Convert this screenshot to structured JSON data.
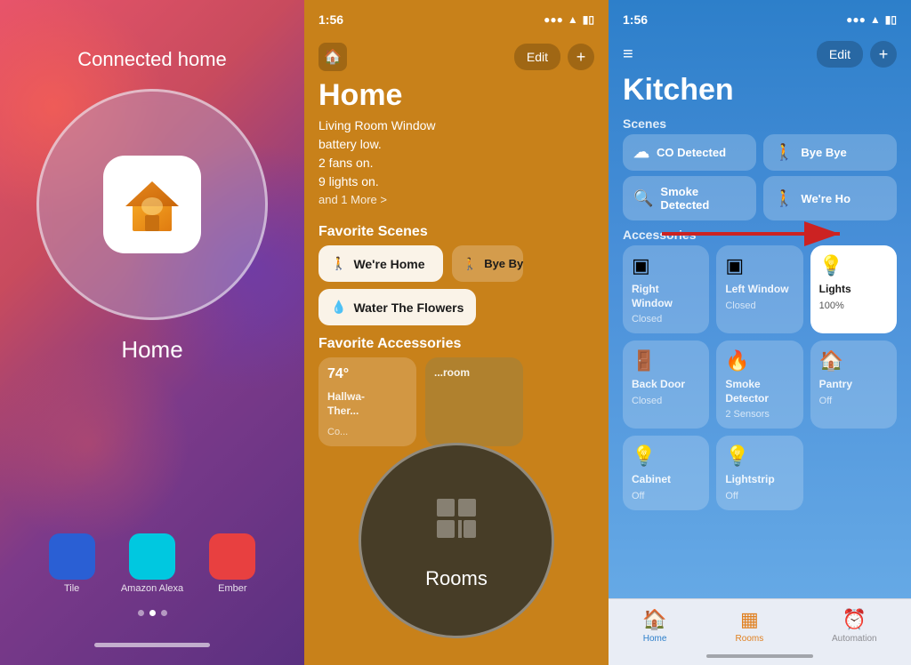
{
  "panel1": {
    "status_time": "",
    "connected_home": "Connected home",
    "home_label": "Home",
    "bottom_apps": [
      {
        "label": "Tile",
        "color": "#3a7bd5"
      },
      {
        "label": "Amazon Alexa",
        "color": "#1a73e8"
      },
      {
        "label": "Ember",
        "color": "#e84040"
      }
    ]
  },
  "panel2": {
    "status_time": "1:56",
    "title": "Home",
    "subtitle_line1": "Living Room Window",
    "subtitle_line2": "battery low.",
    "subtitle_line3": "2 fans on.",
    "subtitle_line4": "9 lights on.",
    "more_text": "and 1 More >",
    "favorite_scenes_label": "Favorite Scenes",
    "scenes": [
      {
        "icon": "🚶",
        "label": "We're Home"
      },
      {
        "icon": "🚶",
        "label": "Bye Bye"
      }
    ],
    "scene_water": {
      "icon": "💧",
      "label": "Water The Flowers"
    },
    "favorite_accessories_label": "Favorite Accessories",
    "accessories": [
      {
        "temp": "74°",
        "name": "Hallwa-\nTher...",
        "sub": "Co..."
      },
      {
        "name": "...room",
        "sub": ""
      }
    ],
    "rooms_label": "Rooms",
    "edit_label": "Edit"
  },
  "panel3": {
    "status_time": "1:56",
    "title": "Kitchen",
    "scenes_label": "Scenes",
    "scenes": [
      {
        "icon": "☁",
        "label": "CO Detected"
      },
      {
        "icon": "🚶",
        "label": "Bye Bye"
      }
    ],
    "smoke_scene": {
      "icon": "🔍",
      "label": "Smoke Detected"
    },
    "were_home_scene": {
      "icon": "🚶",
      "label": "We're Ho"
    },
    "accessories_label": "Accessories",
    "accessories": [
      {
        "icon": "▣",
        "name": "Right Window",
        "sub": "Closed"
      },
      {
        "icon": "▣",
        "name": "Left Window",
        "sub": "Closed"
      },
      {
        "icon": "💡",
        "name": "Lights",
        "sub": "100%",
        "white": true
      },
      {
        "icon": "🚪",
        "name": "Back Door",
        "sub": "Closed"
      },
      {
        "icon": "🔥",
        "name": "Smoke Detector",
        "sub": "2 Sensors"
      },
      {
        "icon": "🏠",
        "name": "Pantry",
        "sub": "Off"
      },
      {
        "icon": "💡",
        "name": "Cabinet",
        "sub": "Off"
      },
      {
        "icon": "💡",
        "name": "Lightstrip",
        "sub": "Off"
      }
    ],
    "tabs": [
      {
        "icon": "🏠",
        "label": "Home"
      },
      {
        "icon": "▦",
        "label": "Rooms",
        "active": true
      },
      {
        "icon": "⏰",
        "label": "Automation"
      }
    ],
    "edit_label": "Edit"
  }
}
